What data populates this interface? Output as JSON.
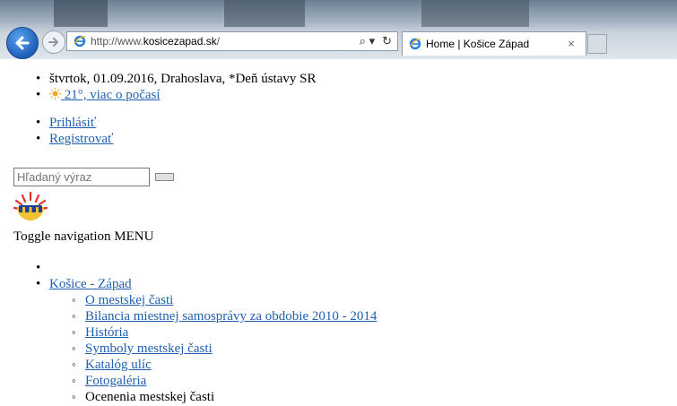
{
  "browser": {
    "url_prefix": "http://www.",
    "url_domain": "kosicezapad.sk",
    "url_suffix": "/",
    "tab_title": "Home | Košice Západ",
    "search_glyph": "⌕ ▾",
    "refresh_glyph": "↻",
    "close_glyph": "×"
  },
  "header": {
    "date_line": "štvrtok, 01.09.2016, Drahoslava, *Deň ústavy SR",
    "weather_link": " 21°, viac o počasí"
  },
  "account": {
    "login": "Prihlásiť",
    "register": "Registrovať"
  },
  "search": {
    "placeholder": "Hľadaný výraz"
  },
  "nav": {
    "toggle_label": "Toggle navigation MENU",
    "main_item": "Košice - Západ",
    "sub_items": [
      {
        "label": "O mestskej časti",
        "link": true
      },
      {
        "label": "Bilancia miestnej samosprávy za obdobie 2010 - 2014",
        "link": true
      },
      {
        "label": "História",
        "link": true
      },
      {
        "label": "Symboly mestskej časti",
        "link": true
      },
      {
        "label": "Katalóg ulíc",
        "link": true
      },
      {
        "label": "Fotogaléria",
        "link": true
      },
      {
        "label": "Ocenenia mestskej časti",
        "link": false
      }
    ]
  },
  "colors": {
    "link": "#1f5fb0",
    "logo_blue": "#1b3f9c",
    "logo_yellow": "#f2c230",
    "logo_red": "#e0312b"
  }
}
